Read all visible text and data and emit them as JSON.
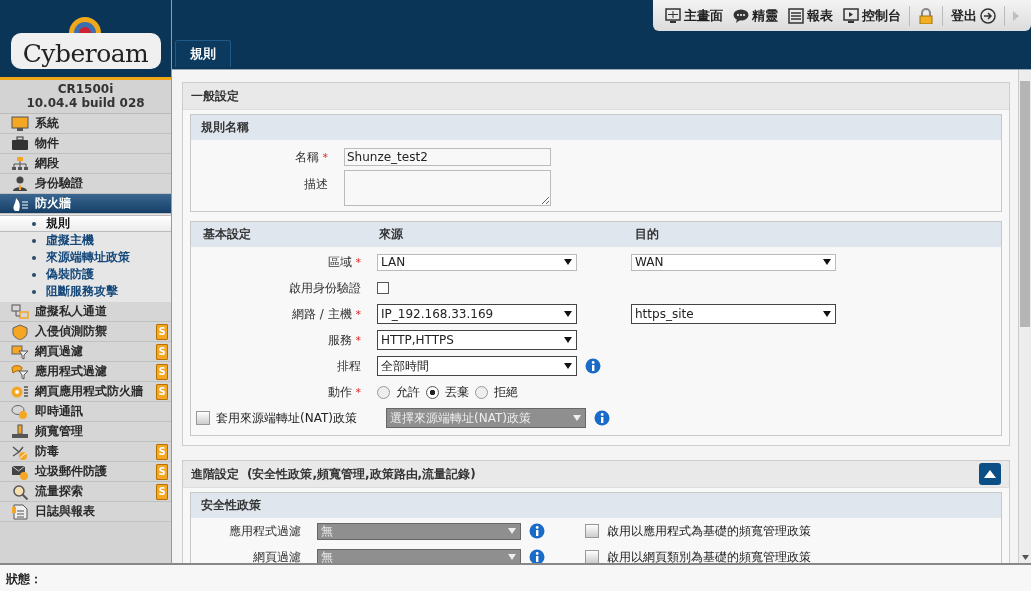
{
  "toolbar": {
    "items": [
      {
        "label": "主畫面"
      },
      {
        "label": "精靈"
      },
      {
        "label": "報表"
      },
      {
        "label": "控制台"
      },
      {
        "kind": "lock"
      },
      {
        "label": "登出"
      }
    ],
    "next_disabled": true
  },
  "logo": {
    "text": "Cyberoam"
  },
  "device": {
    "model": "CR1500i",
    "version": "10.04.4 build 028"
  },
  "sidebar": {
    "items": [
      {
        "label": "系統",
        "expanded": false
      },
      {
        "label": "物件",
        "expanded": false
      },
      {
        "label": "網段",
        "expanded": false
      },
      {
        "label": "身份驗證",
        "expanded": false
      },
      {
        "label": "防火牆",
        "expanded": true,
        "children": [
          {
            "label": "規則",
            "selected": true
          },
          {
            "label": "虛擬主機",
            "selected": false
          },
          {
            "label": "來源端轉址政策",
            "selected": false
          },
          {
            "label": "偽裝防護",
            "selected": false
          },
          {
            "label": "阻斷服務攻擊",
            "selected": false
          }
        ]
      },
      {
        "label": "虛擬私人通道",
        "expanded": false
      },
      {
        "label": "入侵偵測防禦",
        "expanded": false,
        "badge": "S"
      },
      {
        "label": "網頁過濾",
        "expanded": false,
        "badge": "S"
      },
      {
        "label": "應用程式過濾",
        "expanded": false,
        "badge": "S"
      },
      {
        "label": "網頁應用程式防火牆",
        "expanded": false,
        "badge": "S"
      },
      {
        "label": "即時通訊",
        "expanded": false
      },
      {
        "label": "頻寬管理",
        "expanded": false
      },
      {
        "label": "防毒",
        "expanded": false,
        "badge": "S"
      },
      {
        "label": "垃圾郵件防護",
        "expanded": false,
        "badge": "S"
      },
      {
        "label": "流量探索",
        "expanded": false,
        "badge": "S"
      },
      {
        "label": "日誌與報表",
        "expanded": false
      }
    ]
  },
  "tabs": [
    {
      "label": "規則",
      "selected": true
    }
  ],
  "general": {
    "title": "一般設定",
    "section": "規則名稱",
    "name": {
      "label": "名稱",
      "required_mark": "*",
      "value": "Shunze_test2"
    },
    "description": {
      "label": "描述"
    }
  },
  "basic": {
    "title": "基本設定",
    "source_heading": "來源",
    "destination_heading": "目的",
    "rows": [
      {
        "kind": "select",
        "label": "區域",
        "required_mark": "*",
        "source": "LAN",
        "destination": "WAN"
      },
      {
        "kind": "checkbox",
        "label": "啟用身份驗證",
        "checked": false
      },
      {
        "kind": "select",
        "label": "網路 / 主機",
        "required_mark": "*",
        "source": "IP_192.168.33.169",
        "destination": "https_site"
      },
      {
        "kind": "select",
        "label": "服務",
        "required_mark": "*",
        "source": "HTTP,HTTPS"
      },
      {
        "kind": "select",
        "label": "排程",
        "source": "全部時間",
        "info": true
      },
      {
        "kind": "radio",
        "label": "動作",
        "required_mark": "*",
        "options": [
          {
            "label": "允許",
            "selected": false
          },
          {
            "label": "丟棄",
            "selected": true
          },
          {
            "label": "拒絕",
            "selected": false
          }
        ]
      },
      {
        "kind": "nat",
        "label": "套用來源端轉址(NAT)政策",
        "checked": false,
        "select": "選擇來源端轉址(NAT)政策",
        "disabled": true,
        "info": true
      }
    ]
  },
  "advanced": {
    "title": "進階設定",
    "subtitle": "(安全性政策,頻寬管理,政策路由,流量記錄)",
    "expanded": true,
    "section": "安全性政策",
    "rows": [
      {
        "label": "應用程式過濾",
        "select": "無",
        "disabled": true,
        "option": "啟用以應用程式為基礎的頻寬管理政策",
        "checked": false
      },
      {
        "label": "網頁過濾",
        "select": "無",
        "disabled": true,
        "option": "啟用以網頁類別為基礎的頻寬管理政策",
        "checked": false
      }
    ]
  },
  "status_bar": {
    "label": "狀態："
  }
}
